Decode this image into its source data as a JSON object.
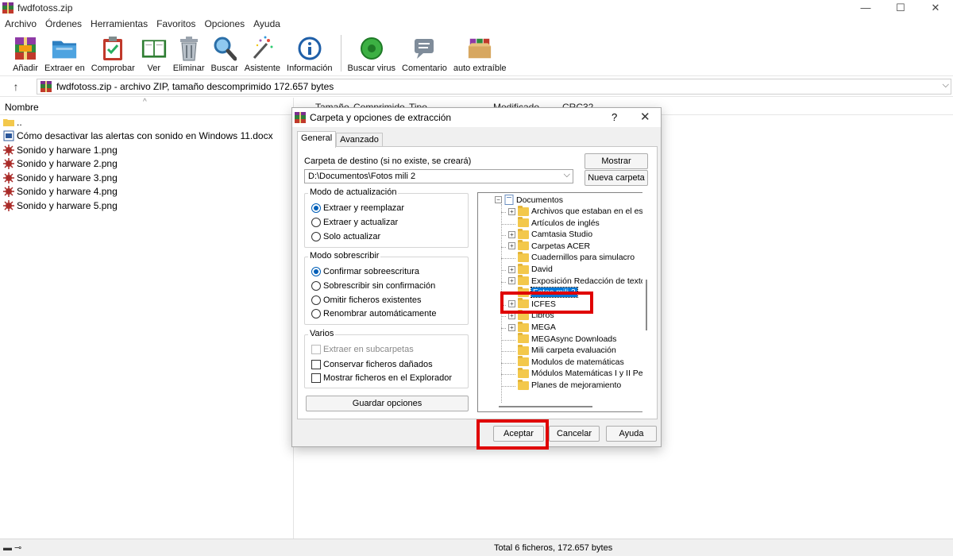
{
  "window": {
    "title": "fwdfotoss.zip",
    "controls": {
      "minimize": "—",
      "maximize": "☐",
      "close": "✕"
    }
  },
  "menu": [
    "Archivo",
    "Órdenes",
    "Herramientas",
    "Favoritos",
    "Opciones",
    "Ayuda"
  ],
  "toolbar": {
    "group1": [
      {
        "label": "Añadir",
        "icon": "add-archive-icon"
      },
      {
        "label": "Extraer en",
        "icon": "extract-folder-icon"
      },
      {
        "label": "Comprobar",
        "icon": "test-clipboard-icon"
      },
      {
        "label": "Ver",
        "icon": "view-book-icon"
      },
      {
        "label": "Eliminar",
        "icon": "trash-icon"
      },
      {
        "label": "Buscar",
        "icon": "search-magnifier-icon"
      },
      {
        "label": "Asistente",
        "icon": "wizard-wand-icon"
      },
      {
        "label": "Información",
        "icon": "info-icon"
      }
    ],
    "group2": [
      {
        "label": "Buscar virus",
        "icon": "virus-scan-icon"
      },
      {
        "label": "Comentario",
        "icon": "comment-icon"
      },
      {
        "label": "auto extraíble",
        "icon": "sfx-box-icon"
      }
    ]
  },
  "address": {
    "up_arrow": "↑",
    "path": "fwdfotoss.zip - archivo ZIP, tamaño descomprimido 172.657 bytes",
    "dropdown": "⌵"
  },
  "file_list": {
    "header": {
      "name": "Nombre",
      "sort_indicator": "^"
    },
    "right_columns": [
      "Tamaño",
      "Comprimido",
      "Tipo",
      "Modificado",
      "CRC32"
    ],
    "rows": [
      {
        "name": "..",
        "type": "parent-folder"
      },
      {
        "name": "Cómo desactivar las alertas con sonido en Windows 11.docx",
        "type": "docx"
      },
      {
        "name": "Sonido y harware 1.png",
        "type": "png"
      },
      {
        "name": "Sonido y harware 2.png",
        "type": "png"
      },
      {
        "name": "Sonido y harware 3.png",
        "type": "png"
      },
      {
        "name": "Sonido y harware 4.png",
        "type": "png"
      },
      {
        "name": "Sonido y harware 5.png",
        "type": "png"
      }
    ]
  },
  "status": {
    "left_icons": "▬ ⊸",
    "total": "Total 6 ficheros, 172.657 bytes"
  },
  "dialog": {
    "title": "Carpeta y opciones de extracción",
    "help": "?",
    "close": "✕",
    "tabs": [
      "General",
      "Avanzado"
    ],
    "destination_label": "Carpeta de destino (si no existe, se creará)",
    "destination_value": "D:\\Documentos\\Fotos mili 2",
    "buttons": {
      "show": "Mostrar",
      "new_folder": "Nueva carpeta",
      "save_options": "Guardar opciones",
      "ok": "Aceptar",
      "cancel": "Cancelar",
      "help": "Ayuda"
    },
    "update_mode": {
      "title": "Modo de actualización",
      "options": [
        "Extraer y reemplazar",
        "Extraer y actualizar",
        "Solo actualizar"
      ],
      "selected": 0
    },
    "overwrite_mode": {
      "title": "Modo sobrescribir",
      "options": [
        "Confirmar sobreescritura",
        "Sobrescribir sin confirmación",
        "Omitir ficheros existentes",
        "Renombrar automáticamente"
      ],
      "selected": 0
    },
    "misc": {
      "title": "Varios",
      "options": [
        {
          "label": "Extraer en subcarpetas",
          "checked": false,
          "disabled": true
        },
        {
          "label": "Conservar ficheros dañados",
          "checked": false,
          "disabled": false
        },
        {
          "label": "Mostrar ficheros en el Explorador",
          "checked": false,
          "disabled": false
        }
      ]
    },
    "tree": {
      "root": "Documentos",
      "items": [
        {
          "label": "Archivos que estaban en el esc",
          "expandable": true
        },
        {
          "label": "Artículos de inglés",
          "expandable": false
        },
        {
          "label": "Camtasia Studio",
          "expandable": true
        },
        {
          "label": "Carpetas ACER",
          "expandable": true
        },
        {
          "label": "Cuadernillos para simulacro",
          "expandable": false
        },
        {
          "label": "David",
          "expandable": true
        },
        {
          "label": "Exposición Redacción de texto",
          "expandable": true
        },
        {
          "label": "Fotos mili 2",
          "expandable": false,
          "selected": true
        },
        {
          "label": "ICFES",
          "expandable": true
        },
        {
          "label": "Libros",
          "expandable": true
        },
        {
          "label": "MEGA",
          "expandable": true
        },
        {
          "label": "MEGAsync Downloads",
          "expandable": false
        },
        {
          "label": "Mili carpeta evaluación",
          "expandable": false
        },
        {
          "label": "Modulos de matemáticas",
          "expandable": false
        },
        {
          "label": "Módulos Matemáticas I y II Per",
          "expandable": false
        },
        {
          "label": "Planes de mejoramiento",
          "expandable": false
        }
      ]
    }
  },
  "colors": {
    "highlight_box": "#e00000",
    "selection": "#0078d7",
    "folder": "#f3c84b",
    "radio_selected": "#005fb8"
  }
}
